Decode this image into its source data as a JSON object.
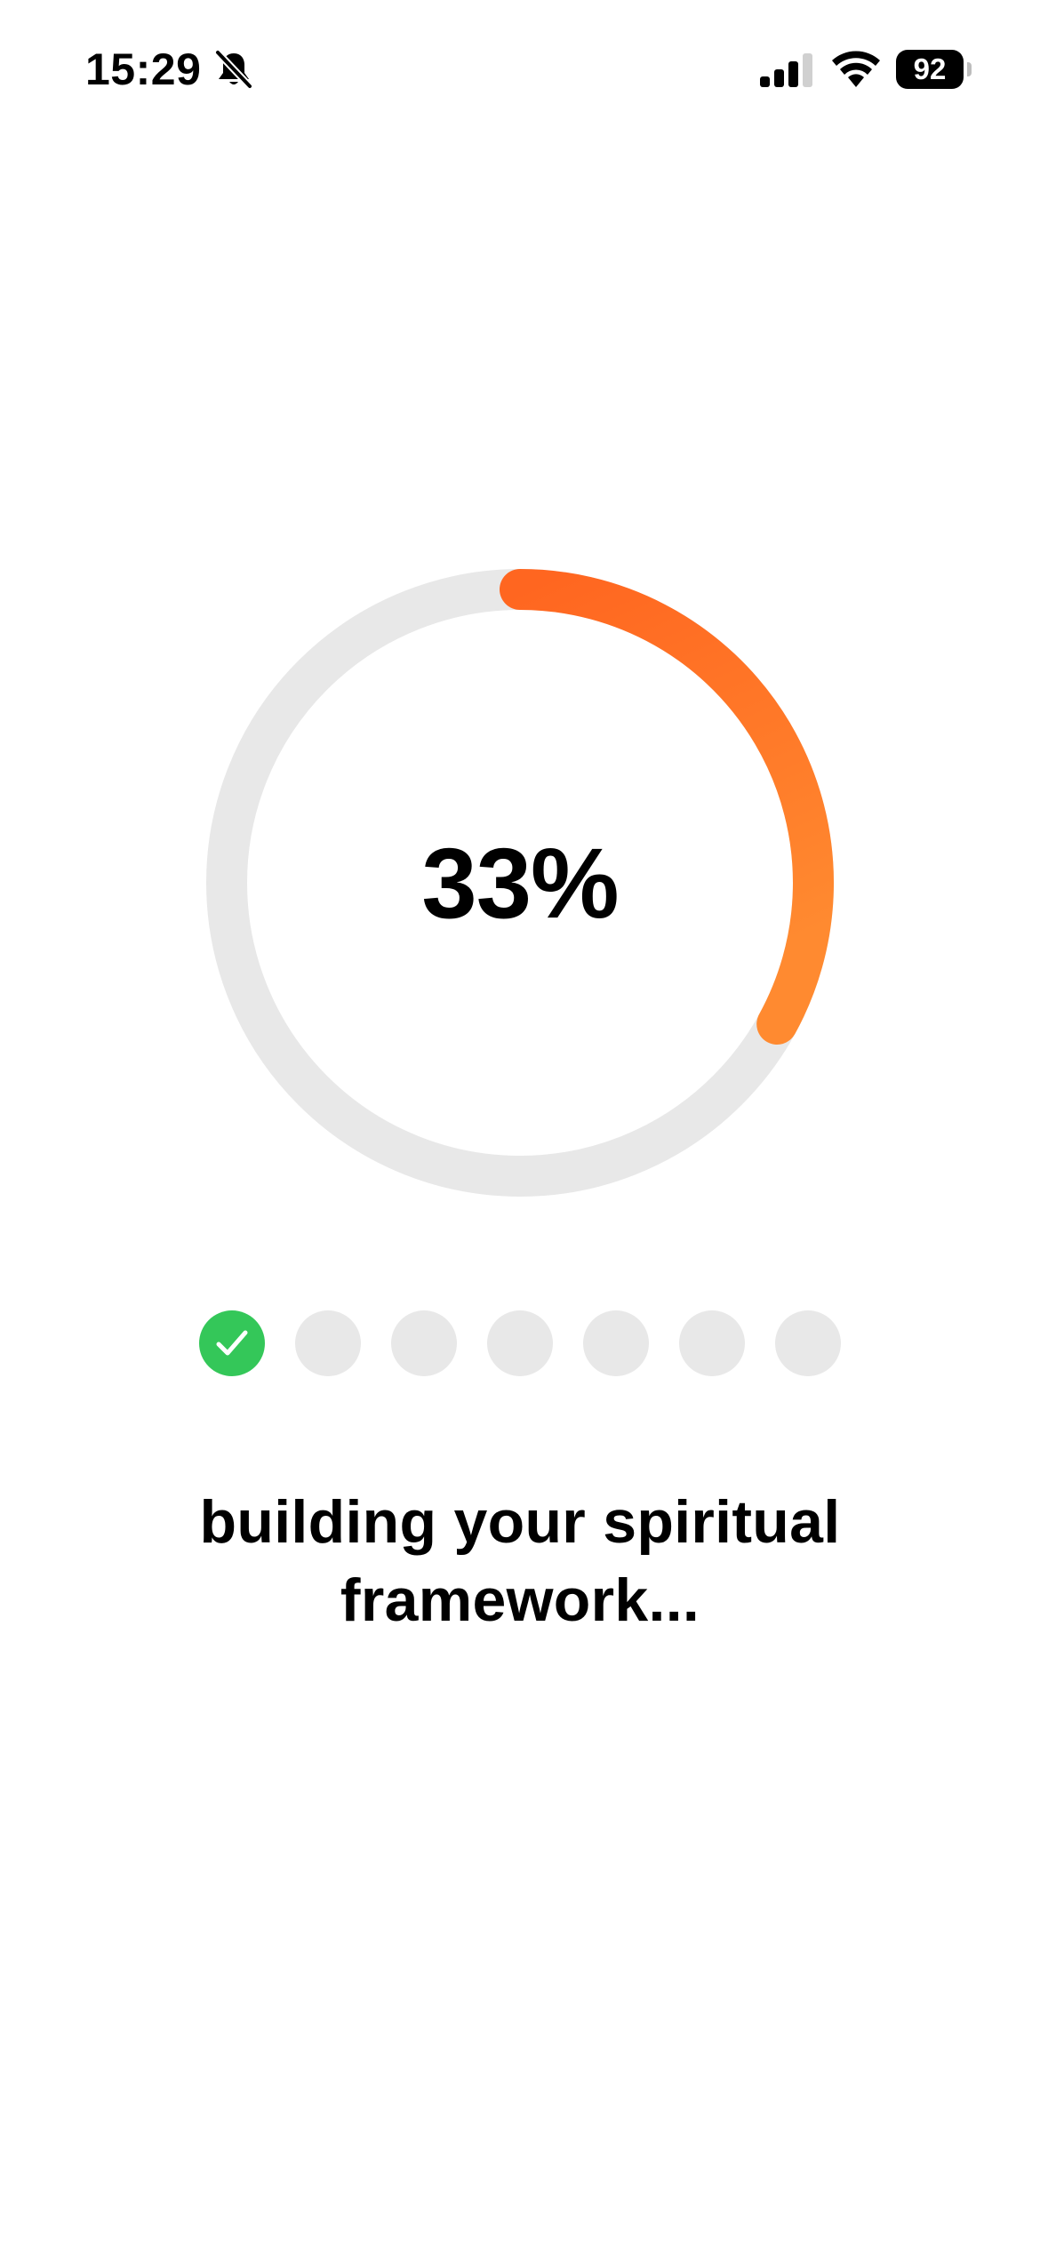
{
  "status_bar": {
    "time": "15:29",
    "battery_level": "92",
    "icons": [
      "bell-slash-icon",
      "cellular-signal-icon",
      "wifi-icon",
      "battery-icon"
    ],
    "signal_bars_active": 3,
    "signal_bars_total": 4
  },
  "progress": {
    "percent_label": "33%",
    "value": 0.33,
    "track_color": "#e8e8e8",
    "gradient_start_color": "#ff6620",
    "gradient_end_color": "#ff8a30"
  },
  "steps": {
    "total": 7,
    "completed": 1,
    "completed_color": "#34c759",
    "pending_color": "#e8e8e8",
    "completed_icon": "checkmark-icon"
  },
  "message": {
    "text": "building your spiritual framework..."
  }
}
